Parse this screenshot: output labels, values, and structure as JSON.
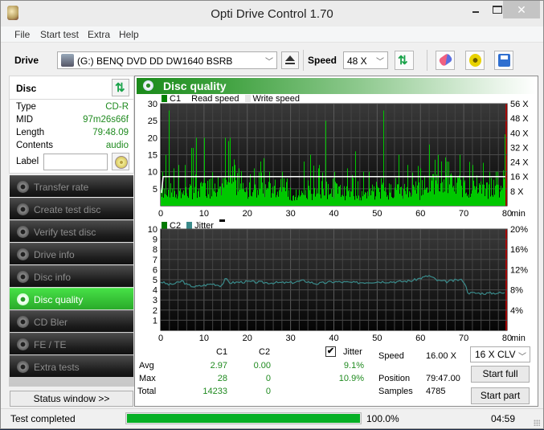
{
  "window": {
    "title": "Opti Drive Control 1.70",
    "controls": {
      "close": "✕"
    }
  },
  "menu": [
    "File",
    "Start test",
    "Extra",
    "Help"
  ],
  "toolbar": {
    "drive_label": "Drive",
    "drive_value": "(G:)   BENQ DVD DD DW1640 BSRB",
    "speed_label": "Speed",
    "speed_value": "48 X",
    "icons": [
      "drive-icon",
      "eject-icon",
      "refresh-icon",
      "eraser-icon",
      "settings-icon",
      "save-icon"
    ]
  },
  "disc": {
    "heading": "Disc",
    "rows": [
      {
        "key": "Type",
        "value": "CD-R"
      },
      {
        "key": "MID",
        "value": "97m26s66f"
      },
      {
        "key": "Length",
        "value": "79:48.09"
      },
      {
        "key": "Contents",
        "value": "audio"
      }
    ],
    "label_key": "Label",
    "label_value": ""
  },
  "nav": {
    "items": [
      {
        "label": "Transfer rate",
        "active": false
      },
      {
        "label": "Create test disc",
        "active": false
      },
      {
        "label": "Verify test disc",
        "active": false
      },
      {
        "label": "Drive info",
        "active": false
      },
      {
        "label": "Disc info",
        "active": false
      },
      {
        "label": "Disc quality",
        "active": true
      },
      {
        "label": "CD Bler",
        "active": false
      },
      {
        "label": "FE / TE",
        "active": false
      },
      {
        "label": "Extra tests",
        "active": false
      }
    ],
    "status_window_button": "Status window >>"
  },
  "panel": {
    "title": "Disc quality"
  },
  "colors": {
    "c1": "#00c800",
    "c2": "#007a00",
    "jitter": "#3a8a8a",
    "read_speed": "#ffffff",
    "write_speed": "#e6e6e6",
    "end_marker": "#d00000",
    "accent": "#1f8a1f"
  },
  "chart_data": [
    {
      "type": "bar",
      "title": "C1 / Read speed",
      "legend": [
        "C1",
        "Read speed",
        "Write speed"
      ],
      "xlabel": "min",
      "xlim": [
        0,
        80
      ],
      "x_ticks": [
        "0",
        "10",
        "20",
        "30",
        "40",
        "50",
        "60",
        "70",
        "80"
      ],
      "ylim": [
        0,
        30
      ],
      "y_ticks": [
        "5",
        "10",
        "15",
        "20",
        "25",
        "30"
      ],
      "y2lim": [
        0,
        56
      ],
      "y2_ticks": [
        "8 X",
        "16 X",
        "24 X",
        "32 X",
        "40 X",
        "48 X",
        "56 X"
      ],
      "grid": true,
      "read_speed_x": 16,
      "c1_peaks": [
        [
          0.3,
          10
        ],
        [
          1.2,
          15
        ],
        [
          1.8,
          28
        ],
        [
          3,
          11
        ],
        [
          4,
          12
        ],
        [
          5.5,
          12
        ],
        [
          7,
          17
        ],
        [
          7.5,
          17
        ],
        [
          8.2,
          20
        ],
        [
          10,
          20
        ],
        [
          11.5,
          8
        ],
        [
          14.8,
          20
        ],
        [
          16,
          20
        ],
        [
          15.5,
          19
        ],
        [
          17,
          12
        ],
        [
          18,
          11
        ],
        [
          21.5,
          11
        ],
        [
          23,
          13
        ],
        [
          23.8,
          14
        ],
        [
          25,
          10
        ],
        [
          28,
          10
        ],
        [
          33,
          13
        ],
        [
          34.5,
          15
        ],
        [
          36.5,
          12
        ],
        [
          38,
          25
        ],
        [
          40,
          10
        ],
        [
          43,
          11
        ],
        [
          45,
          16
        ],
        [
          48,
          10
        ],
        [
          51.5,
          28
        ],
        [
          55,
          15
        ],
        [
          57,
          12
        ],
        [
          60,
          11
        ],
        [
          62,
          18
        ],
        [
          64,
          15
        ],
        [
          66,
          13
        ],
        [
          69,
          15
        ],
        [
          72,
          12
        ],
        [
          76,
          10
        ],
        [
          79.5,
          21
        ]
      ],
      "c1_baseline": [
        [
          0,
          5
        ],
        [
          5,
          4
        ],
        [
          10,
          5
        ],
        [
          15,
          6
        ],
        [
          17,
          8
        ],
        [
          20,
          4
        ],
        [
          25,
          5
        ],
        [
          30,
          3
        ],
        [
          35,
          4
        ],
        [
          40,
          5
        ],
        [
          45,
          3
        ],
        [
          50,
          4
        ],
        [
          55,
          5
        ],
        [
          60,
          4
        ],
        [
          62,
          6
        ],
        [
          65,
          7
        ],
        [
          70,
          6
        ],
        [
          75,
          5
        ],
        [
          80,
          4
        ]
      ],
      "c1_max": 28
    },
    {
      "type": "line",
      "title": "C2 / Jitter",
      "legend": [
        "C2",
        "Jitter"
      ],
      "xlabel": "min",
      "xlim": [
        0,
        80
      ],
      "x_ticks": [
        "0",
        "10",
        "20",
        "30",
        "40",
        "50",
        "60",
        "70",
        "80"
      ],
      "ylim": [
        0,
        10
      ],
      "y_ticks": [
        "1",
        "2",
        "3",
        "4",
        "5",
        "6",
        "7",
        "8",
        "9",
        "10"
      ],
      "y2lim": [
        0,
        20
      ],
      "y2_ticks": [
        "4%",
        "8%",
        "12%",
        "16%",
        "20%"
      ],
      "grid": true,
      "c2_values": "all 0",
      "jitter_percent": [
        [
          0,
          9.6
        ],
        [
          2,
          9.0
        ],
        [
          4,
          9.4
        ],
        [
          5,
          9.8
        ],
        [
          6,
          9.0
        ],
        [
          8,
          8.6
        ],
        [
          10,
          8.9
        ],
        [
          12,
          9.2
        ],
        [
          14,
          8.8
        ],
        [
          15,
          10.2
        ],
        [
          16,
          9.4
        ],
        [
          20,
          9.6
        ],
        [
          25,
          9.4
        ],
        [
          30,
          9.4
        ],
        [
          33,
          9.8
        ],
        [
          36,
          9.2
        ],
        [
          40,
          9.6
        ],
        [
          45,
          9.4
        ],
        [
          50,
          9.6
        ],
        [
          55,
          9.6
        ],
        [
          58,
          9.8
        ],
        [
          62,
          10.8
        ],
        [
          64,
          9.8
        ],
        [
          66,
          9.6
        ],
        [
          69,
          10.0
        ],
        [
          70,
          9.8
        ],
        [
          71,
          7.4
        ],
        [
          75,
          7.3
        ],
        [
          78,
          7.4
        ],
        [
          80,
          7.3
        ]
      ]
    }
  ],
  "stats": {
    "headers": {
      "c1": "C1",
      "c2": "C2",
      "jitter": "Jitter"
    },
    "jitter_checked": true,
    "rows": [
      {
        "label": "Avg",
        "c1": "2.97",
        "c2": "0.00",
        "jitter": "9.1%"
      },
      {
        "label": "Max",
        "c1": "28",
        "c2": "0",
        "jitter": "10.9%"
      },
      {
        "label": "Total",
        "c1": "14233",
        "c2": "0",
        "jitter": ""
      }
    ],
    "speed_label": "Speed",
    "speed_value": "16.00 X",
    "position_label": "Position",
    "position_value": "79:47.00",
    "samples_label": "Samples",
    "samples_value": "4785",
    "mode_select": "16 X CLV",
    "start_full": "Start full",
    "start_part": "Start part"
  },
  "status": {
    "text": "Test completed",
    "progress": 1.0,
    "progress_text": "100.0%",
    "elapsed": "04:59"
  }
}
